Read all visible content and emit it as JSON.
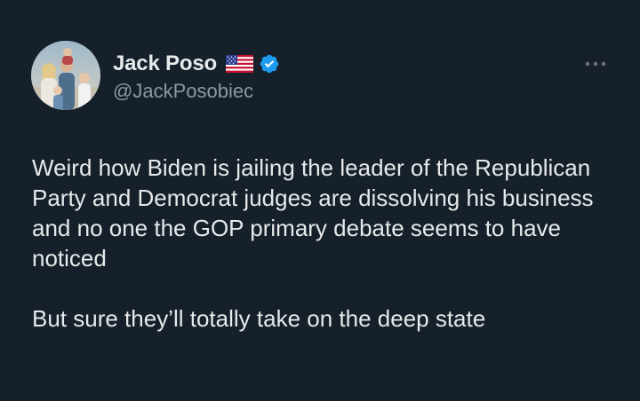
{
  "author": {
    "display_name": "Jack Poso",
    "handle": "@JackPosobiec",
    "flag_icon": "us-flag-icon",
    "verified_icon": "verified-badge-icon",
    "verified_color": "#1d9bf0"
  },
  "more_icon": "more-options-icon",
  "tweet": {
    "paragraphs": [
      "Weird how Biden is jailing the leader of the Republican Party and Democrat judges are dissolving his business and no one the GOP primary debate seems to have noticed",
      "But sure they’ll totally take on the deep state"
    ]
  },
  "colors": {
    "background": "#15202b",
    "text_primary": "#e7e9ea",
    "text_secondary": "#8b98a5"
  }
}
